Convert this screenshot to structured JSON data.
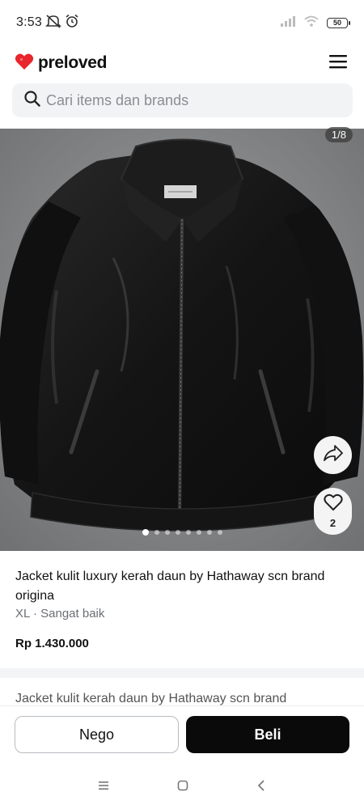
{
  "status_bar": {
    "time": "3:53",
    "battery": "50"
  },
  "header": {
    "brand_name": "preloved",
    "brand_color": "#e8262c"
  },
  "search": {
    "placeholder": "Cari items dan brands"
  },
  "gallery": {
    "counter": "1/8",
    "dot_count": 8,
    "active_dot": 0,
    "like_count": "2"
  },
  "product": {
    "title": "Jacket kulit luxury kerah daun by Hathaway scn brand origina",
    "size": "XL",
    "separator": "·",
    "condition": "Sangat baik",
    "price": "Rp 1.430.000",
    "description_preview": "Jacket kulit kerah daun by Hathaway scn brand"
  },
  "actions": {
    "nego_label": "Nego",
    "buy_label": "Beli"
  }
}
